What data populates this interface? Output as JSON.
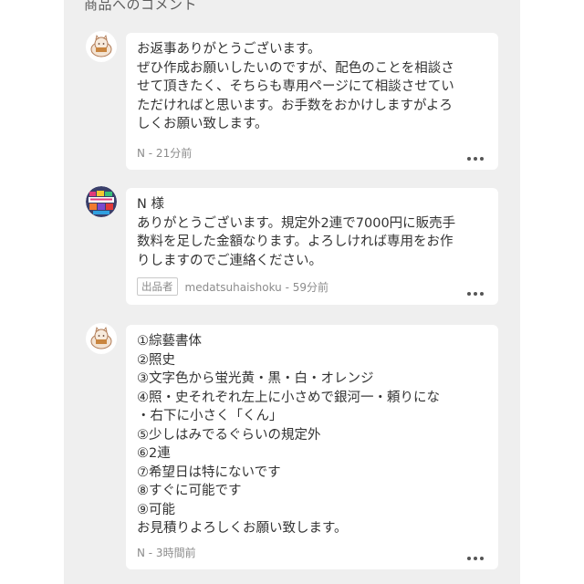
{
  "section": {
    "title": "商品へのコメント"
  },
  "comments": [
    {
      "lines": [
        "お返事ありがとうございます。",
        "ぜひ作成お願いしたいのですが、配色のことを相談さ",
        "せて頂きたく、そちらも専用ページにて相談させてい",
        "ただければと思います。お手数をおかけしますがよろ",
        "しくお願い致します。"
      ],
      "meta": "N - 21分前",
      "menu_icon": "more-dots-icon"
    },
    {
      "lines": [
        "N 様",
        "ありがとうございます。規定外2連で7000円に販売手",
        "数料を足した金額なります。よろしければ専用をお作",
        "りしますのでご連絡ください。"
      ],
      "seller_badge": "出品者",
      "meta": "medatsuhaishoku - 59分前",
      "menu_icon": "more-dots-icon"
    },
    {
      "lines": [
        "①綜藝書体",
        "②照史",
        "③文字色から蛍光黄・黒・白・オレンジ",
        "④照・史それぞれ左上に小さめで銀河一・頼りにな",
        "・右下に小さく「くん」",
        "⑤少しはみでるぐらいの規定外",
        "⑥2連",
        "⑦希望日は特にないです",
        "⑧すぐに可能です",
        "⑨可能",
        "お見積りよろしくお願い致します。"
      ],
      "meta": "N - 3時間前",
      "menu_icon": "more-dots-icon"
    }
  ]
}
